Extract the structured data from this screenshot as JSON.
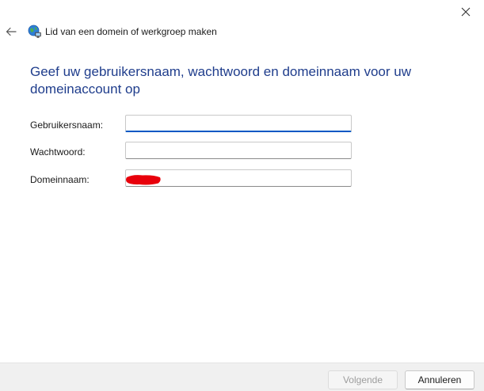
{
  "window": {
    "title": "Lid van een domein of werkgroep maken"
  },
  "main": {
    "instruction": "Geef uw gebruikersnaam, wachtwoord en domeinnaam voor uw domeinaccount op"
  },
  "form": {
    "username": {
      "label": "Gebruikersnaam:",
      "value": ""
    },
    "password": {
      "label": "Wachtwoord:",
      "value": ""
    },
    "domain": {
      "label": "Domeinnaam:",
      "value": ""
    }
  },
  "footer": {
    "next_label": "Volgende",
    "cancel_label": "Annuleren"
  },
  "colors": {
    "heading": "#1f3d8c",
    "focus_accent": "#0058c4",
    "redaction": "#e8000b",
    "footer_bg": "#f0f0f0"
  },
  "icons": {
    "close": "close-icon",
    "back": "back-arrow-icon",
    "wizard": "network-globe-icon"
  }
}
